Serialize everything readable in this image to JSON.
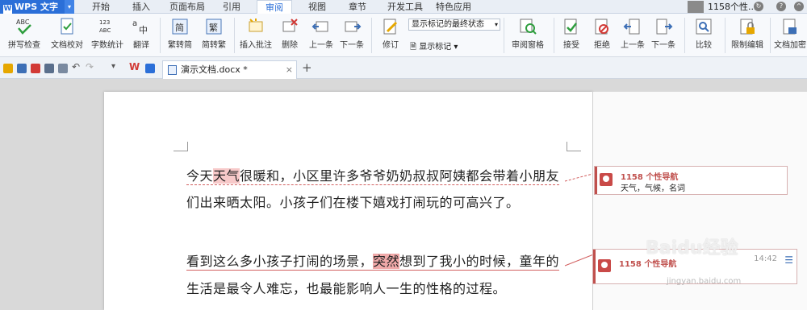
{
  "app": {
    "name": "WPS 文字"
  },
  "menu": {
    "tabs": [
      "开始",
      "插入",
      "页面布局",
      "引用",
      "审阅",
      "视图",
      "章节",
      "开发工具",
      "特色应用"
    ],
    "active": "审阅"
  },
  "user": {
    "name": "1158个性..."
  },
  "ribbon": {
    "buttons": [
      {
        "label": "拼写检查",
        "icon": "abc-check-icon"
      },
      {
        "label": "文档校对",
        "icon": "doc-check-icon"
      },
      {
        "label": "字数统计",
        "icon": "word-count-icon"
      },
      {
        "label": "翻译",
        "icon": "translate-icon"
      },
      {
        "label": "繁转简",
        "icon": "trad-to-simp-icon"
      },
      {
        "label": "简转繁",
        "icon": "simp-to-trad-icon"
      },
      {
        "label": "插入批注",
        "icon": "insert-comment-icon"
      },
      {
        "label": "删除",
        "icon": "delete-comment-icon"
      },
      {
        "label": "上一条",
        "icon": "prev-comment-icon"
      },
      {
        "label": "下一条",
        "icon": "next-comment-icon"
      },
      {
        "label": "修订",
        "icon": "track-changes-icon"
      },
      {
        "label": "审阅窗格",
        "icon": "review-pane-icon"
      },
      {
        "label": "接受",
        "icon": "accept-icon"
      },
      {
        "label": "拒绝",
        "icon": "reject-icon"
      },
      {
        "label": "上一条",
        "icon": "prev-change-icon"
      },
      {
        "label": "下一条",
        "icon": "next-change-icon"
      },
      {
        "label": "比较",
        "icon": "compare-icon"
      },
      {
        "label": "限制编辑",
        "icon": "restrict-edit-icon"
      },
      {
        "label": "文档加密",
        "icon": "encrypt-icon"
      }
    ],
    "markup_state": "显示标记的最终状态",
    "show_markup": "显示标记"
  },
  "doc_tab": {
    "title": "演示文档.docx *"
  },
  "document": {
    "p1_line1": [
      "今天",
      "天气",
      "很暖和，小区里许多爷爷奶奶叔叔阿姨都会带着小朋友"
    ],
    "p1_line2": "们出来晒太阳。小孩子们在楼下嬉戏打闹玩的可高兴了。",
    "p2_line1": [
      "看到这么多小孩子打闹的场景，",
      "突然",
      "想到了我小的时候，童年的"
    ],
    "p2_line2": "生活是最令人难忘，也最能影响人一生的性格的过程。"
  },
  "comments": [
    {
      "author": "1158 个性导航",
      "text": "天气，气候，名词"
    },
    {
      "author": "1158 个性导航",
      "time": "14:42"
    }
  ],
  "watermark": {
    "text": "Baidu经验",
    "sub": "jingyan.baidu.com"
  },
  "colors": {
    "accent": "#2b6fd8",
    "comment": "#c0504d",
    "highlight": "#f7c9c9"
  }
}
